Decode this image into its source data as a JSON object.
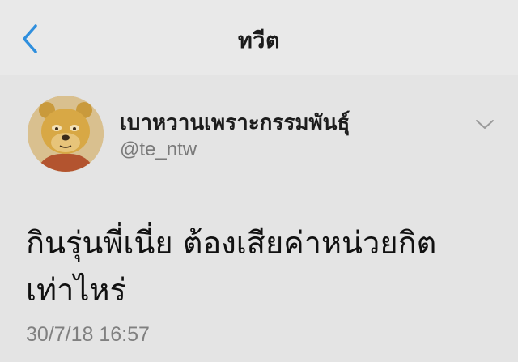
{
  "nav": {
    "title": "ทวีต",
    "back_icon": "chevron-left-icon",
    "accent_color": "#2f8fde"
  },
  "tweet": {
    "author": {
      "display_name": "เบาหวานเพราะกรรมพันธุ์",
      "handle": "@te_ntw",
      "avatar": "winnie-the-pooh-avatar"
    },
    "menu_icon": "chevron-down-icon",
    "text_lines": [
      "กินรุ่นพี่เนี่ย ต้องเสียค่าหน่วยกิต",
      "เท่าไหร่"
    ],
    "timestamp": "30/7/18 16:57"
  }
}
